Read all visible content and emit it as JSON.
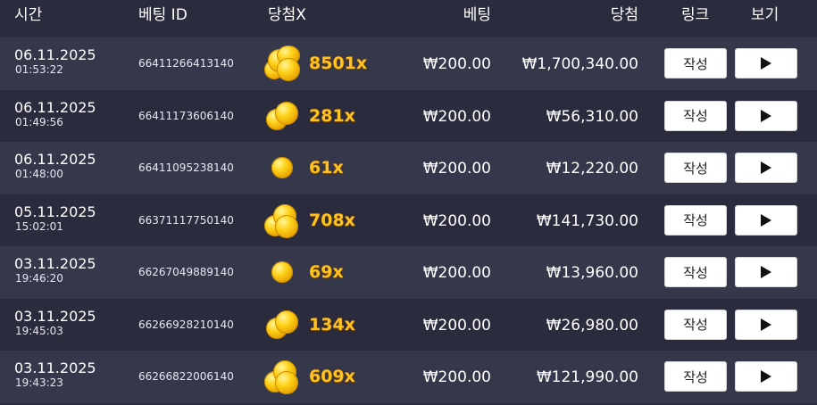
{
  "header": {
    "time": "시간",
    "bet_id": "베팅 ID",
    "multiplier": "당첨X",
    "bet": "베팅",
    "win": "당첨",
    "link": "링크",
    "view": "보기"
  },
  "colors": {
    "background": "#2a2b3d",
    "row_alt": "#35374b",
    "multiplier_gold": "#ffc21f"
  },
  "rows": [
    {
      "date": "06.11.2025",
      "time": "01:53:22",
      "bet_id": "66411266413140",
      "coins": "coin-pile-large",
      "multiplier": "8501x",
      "bet": "₩200.00",
      "win": "₩1,700,340.00",
      "write_label": "작성"
    },
    {
      "date": "06.11.2025",
      "time": "01:49:56",
      "bet_id": "66411173606140",
      "coins": "coin-pair",
      "multiplier": "281x",
      "bet": "₩200.00",
      "win": "₩56,310.00",
      "write_label": "작성"
    },
    {
      "date": "06.11.2025",
      "time": "01:48:00",
      "bet_id": "66411095238140",
      "coins": "coin-single",
      "multiplier": "61x",
      "bet": "₩200.00",
      "win": "₩12,220.00",
      "write_label": "작성"
    },
    {
      "date": "05.11.2025",
      "time": "15:02:01",
      "bet_id": "66371117750140",
      "coins": "coin-triple",
      "multiplier": "708x",
      "bet": "₩200.00",
      "win": "₩141,730.00",
      "write_label": "작성"
    },
    {
      "date": "03.11.2025",
      "time": "19:46:20",
      "bet_id": "66267049889140",
      "coins": "coin-single",
      "multiplier": "69x",
      "bet": "₩200.00",
      "win": "₩13,960.00",
      "write_label": "작성"
    },
    {
      "date": "03.11.2025",
      "time": "19:45:03",
      "bet_id": "66266928210140",
      "coins": "coin-pair",
      "multiplier": "134x",
      "bet": "₩200.00",
      "win": "₩26,980.00",
      "write_label": "작성"
    },
    {
      "date": "03.11.2025",
      "time": "19:43:23",
      "bet_id": "66266822006140",
      "coins": "coin-triple",
      "multiplier": "609x",
      "bet": "₩200.00",
      "win": "₩121,990.00",
      "write_label": "작성"
    }
  ]
}
